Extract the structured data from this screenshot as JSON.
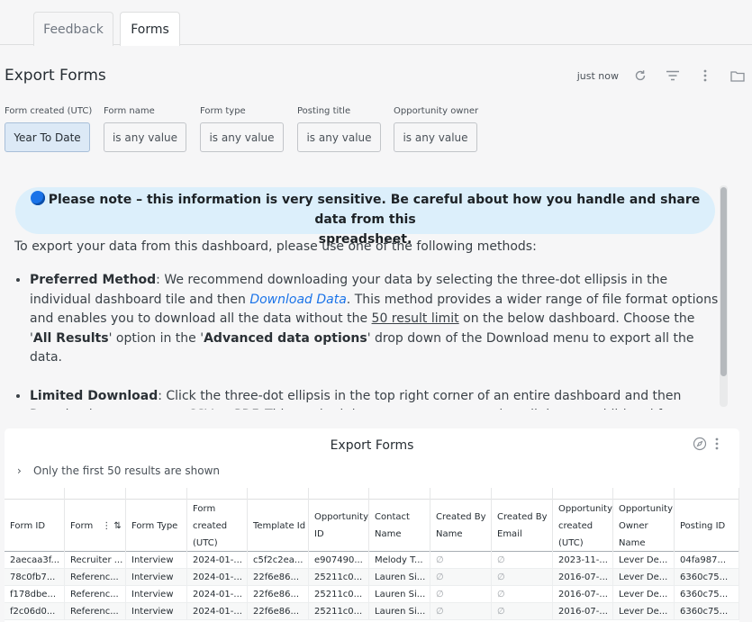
{
  "tabs": [
    {
      "label": "Feedback"
    },
    {
      "label": "Forms"
    }
  ],
  "header": {
    "title": "Export Forms",
    "last_run": "just now"
  },
  "filters": [
    {
      "label": "Form created (UTC)",
      "value": "Year To Date"
    },
    {
      "label": "Form name",
      "value": "is any value"
    },
    {
      "label": "Form type",
      "value": "is any value"
    },
    {
      "label": "Posting title",
      "value": "is any value"
    },
    {
      "label": "Opportunity owner",
      "value": "is any value"
    }
  ],
  "notice": {
    "line1": "Please note – this information is very sensitive. Be careful about how you handle and share data from this",
    "line2": "spreadsheet.",
    "intro": "To export your data from this dashboard, please use one of the following methods:",
    "preferred_label": "Preferred Method",
    "preferred_a": ": We recommend downloading your data by selecting the three-dot ellipsis in the individual dashboard tile and then ",
    "preferred_link": "Download Data",
    "preferred_b": ". This method provides a wider range of file format options and enables you to download all the data without the ",
    "preferred_limit": "50 result limit",
    "preferred_c": " on the below dashboard. Choose the '",
    "preferred_all": "All Results",
    "preferred_d": "' option in the '",
    "preferred_adv": "Advanced data options",
    "preferred_e": "' drop down of the Download menu to export all the data.",
    "limited_label": "Limited Download",
    "limited_text": ": Click the three-dot ellipsis in the top right corner of an entire dashboard and then Download to export as a CSV or PDF. This method does not support exporting all data or additional formats."
  },
  "table_tile": {
    "title": "Export Forms",
    "note": "Only the first 50 results are shown",
    "columns": [
      "Form ID",
      "Form",
      "Form Type",
      "Form created (UTC)",
      "Template Id",
      "Opportunity ID",
      "Contact Name",
      "Created By Name",
      "Created By Email",
      "Opportunity created (UTC)",
      "Opportunity Owner Name",
      "Posting ID"
    ],
    "rows": [
      [
        "2aecaa3f...",
        "Recruiter ...",
        "Interview",
        "2024-01-...",
        "c5f2c2ea...",
        "e907490...",
        "Melody T...",
        "∅",
        "∅",
        "2023-11-...",
        "Lever De...",
        "04fa987..."
      ],
      [
        "78c0fb7...",
        "Referenc...",
        "Interview",
        "2024-01-...",
        "22f6e86...",
        "25211c0...",
        "Lauren Si...",
        "∅",
        "∅",
        "2016-07-...",
        "Lever De...",
        "6360c75..."
      ],
      [
        "f178dbe...",
        "Referenc...",
        "Interview",
        "2024-01-...",
        "22f6e86...",
        "25211c0...",
        "Lauren Si...",
        "∅",
        "∅",
        "2016-07-...",
        "Lever De...",
        "6360c75..."
      ],
      [
        "f2c06d0...",
        "Referenc...",
        "Interview",
        "2024-01-...",
        "22f6e86...",
        "25211c0...",
        "Lauren Si...",
        "∅",
        "∅",
        "2016-07-...",
        "Lever De...",
        "6360c75..."
      ]
    ]
  }
}
